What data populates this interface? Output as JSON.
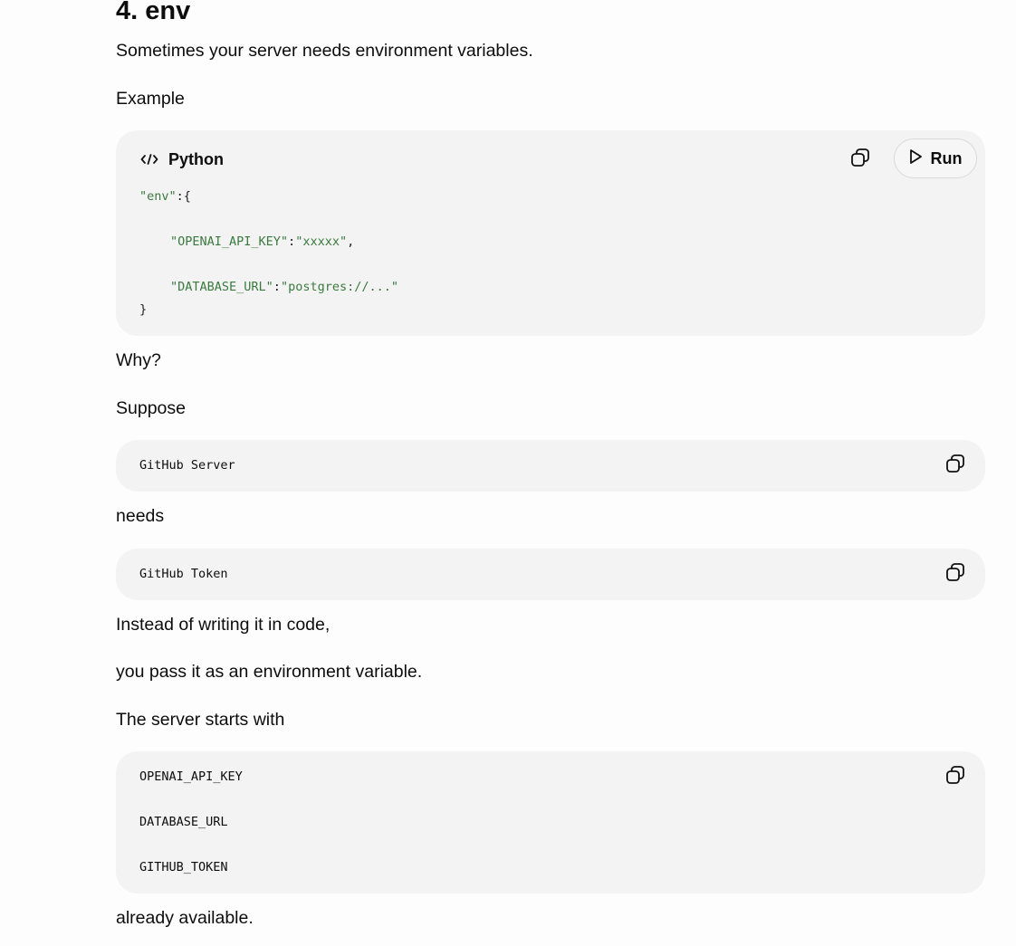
{
  "heading": "4. env",
  "intro": "Sometimes your server needs environment variables.",
  "example_label": "Example",
  "code_block_1": {
    "language": "Python",
    "run_label": "Run",
    "lines": {
      "l1_key": "\"env\"",
      "l1_rest": ":{",
      "l2_key": "\"OPENAI_API_KEY\"",
      "l2_colon": ":",
      "l2_val": "\"xxxxx\"",
      "l2_comma": ",",
      "l3_key": "\"DATABASE_URL\"",
      "l3_colon": ":",
      "l3_val": "\"postgres://...\"",
      "l4": "}"
    }
  },
  "why": "Why?",
  "suppose": "Suppose",
  "code_block_2": {
    "text": "GitHub Server"
  },
  "needs": "needs",
  "code_block_3": {
    "text": "GitHub Token"
  },
  "instead": "Instead of writing it in code,",
  "pass_it": "you pass it as an environment variable.",
  "starts_with": "The server starts with",
  "code_block_4": {
    "lines": [
      "OPENAI_API_KEY",
      "DATABASE_URL",
      "GITHUB_TOKEN"
    ]
  },
  "available": "already available.",
  "icons": {
    "code": "code-icon",
    "copy": "copy-icon",
    "play": "play-icon"
  }
}
